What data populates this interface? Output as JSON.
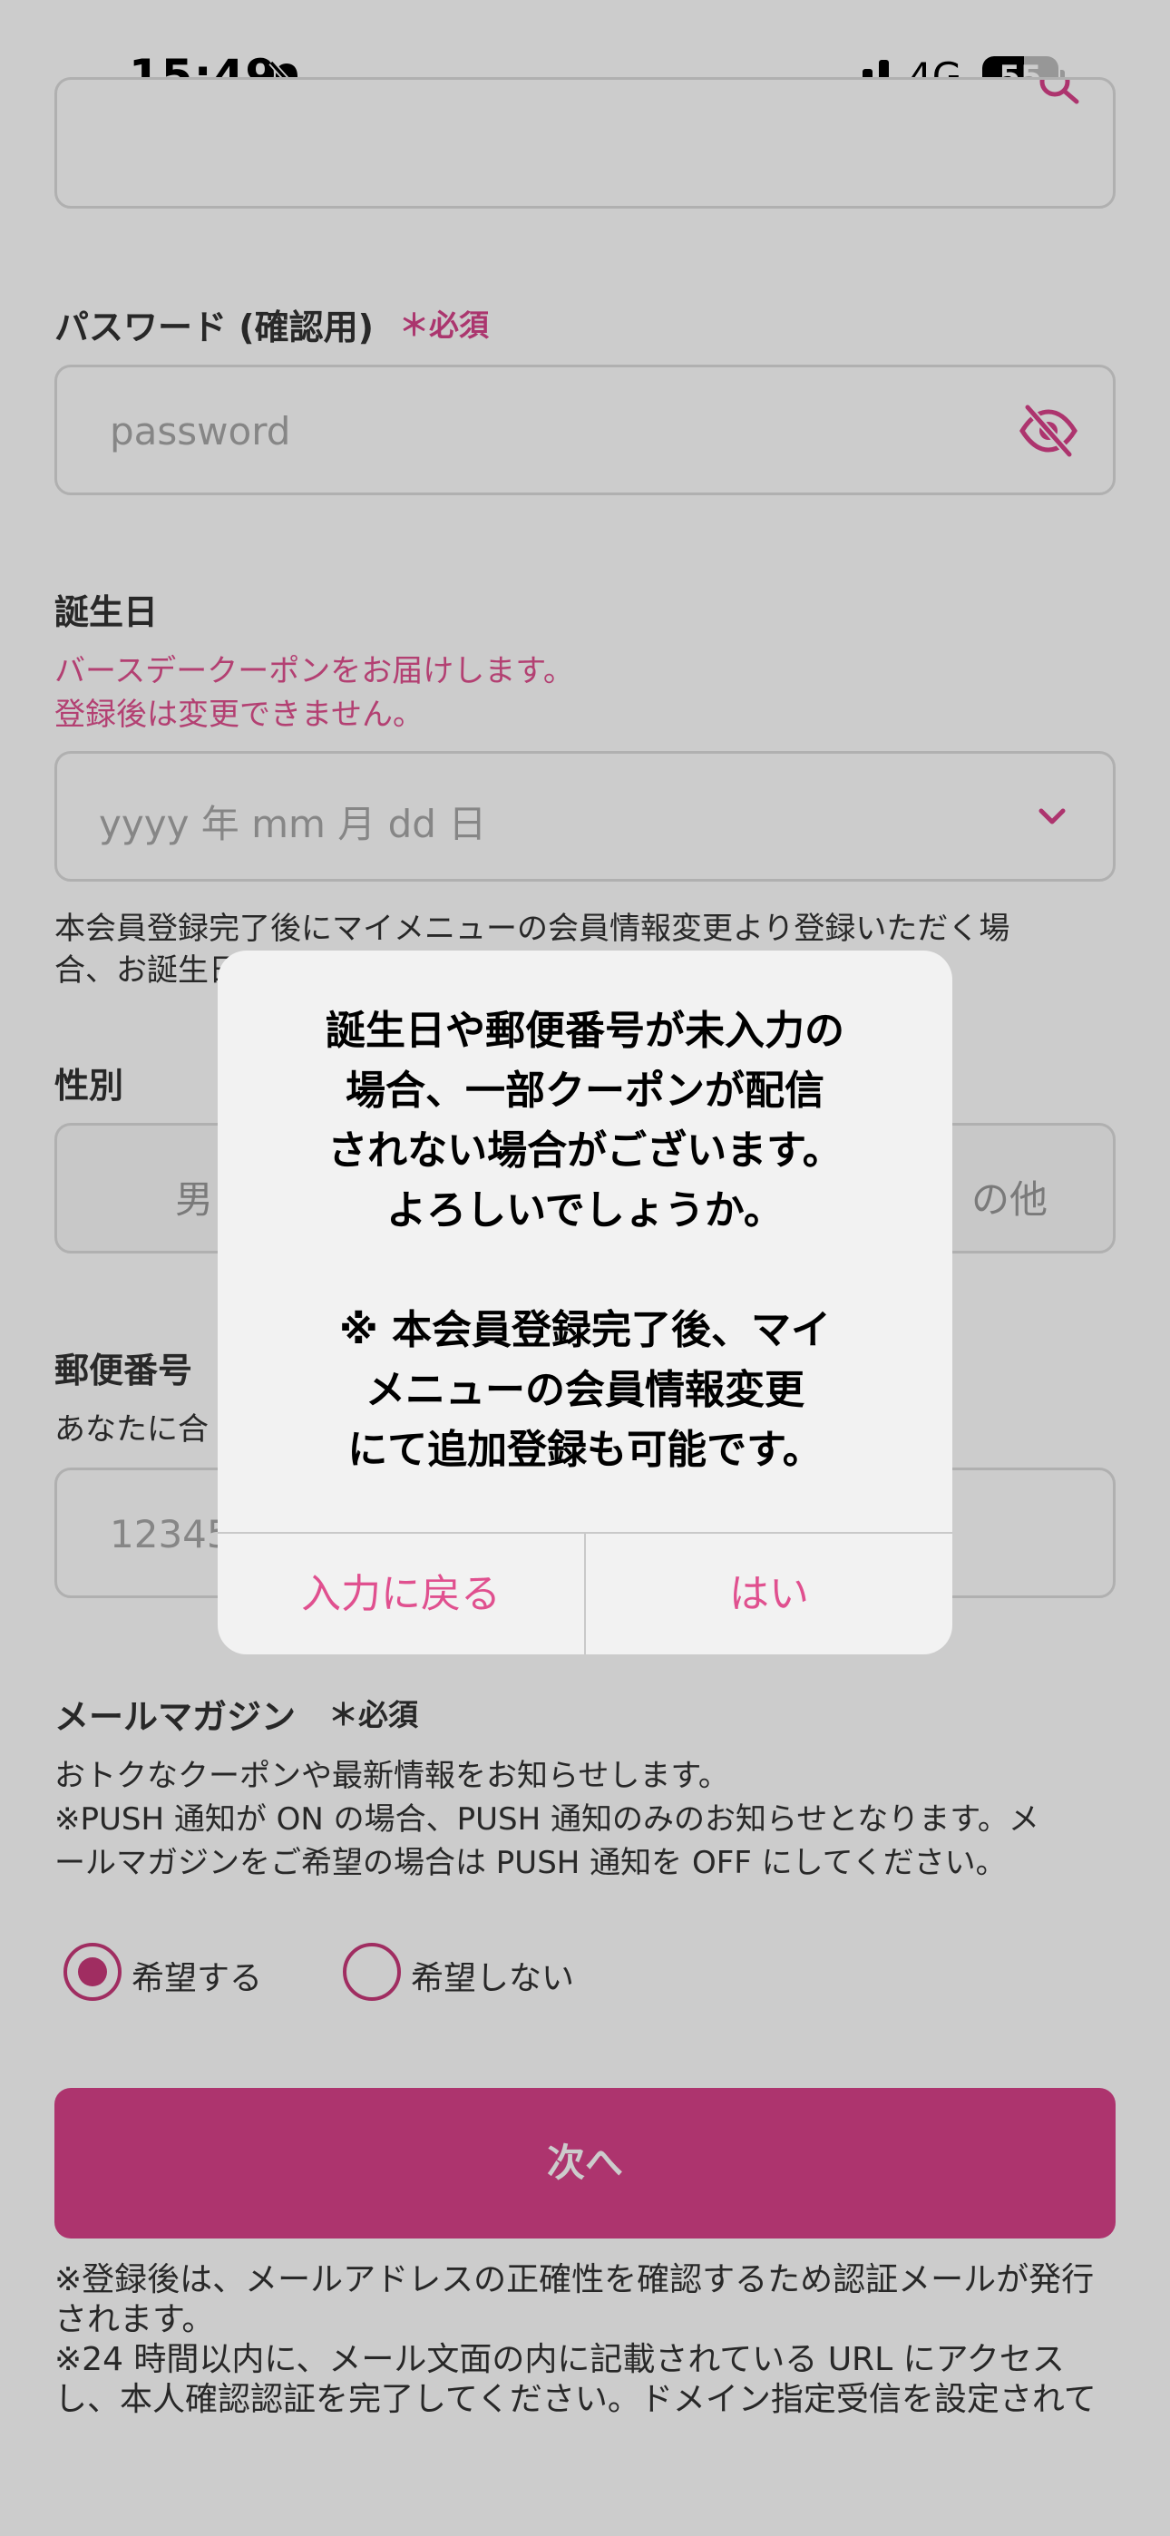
{
  "status_bar": {
    "time": "15:49",
    "network": "4G",
    "battery_level": "55",
    "battery_fraction": 0.55
  },
  "form": {
    "password_confirm": {
      "label": "パスワード (確認用)",
      "required": "＊必須",
      "placeholder": "password"
    },
    "birthday": {
      "label": "誕生日",
      "note_line1": "バースデークーポンをお届けします。",
      "note_line2": "登録後は変更できません。",
      "placeholder": "yyyy 年 mm 月 dd 日",
      "after_note_line1": "本会員登録完了後にマイメニューの会員情報変更より登録いただく場",
      "after_note_line2": "合、お誕生日"
    },
    "gender": {
      "label": "性別",
      "option_left": "男",
      "option_right": "の他"
    },
    "postal": {
      "label": "郵便番号",
      "note": "あなたに合",
      "placeholder": "12345"
    },
    "mail_magazine": {
      "label": "メールマガジン",
      "required": "＊必須",
      "desc_line1": "おトクなクーポンや最新情報をお知らせします。",
      "desc_line2": "※PUSH 通知が ON の場合、PUSH 通知のみのお知らせとなります。メ",
      "desc_line3": "ールマガジンをご希望の場合は PUSH 通知を OFF にしてください。",
      "option_yes": "希望する",
      "option_no": "希望しない"
    },
    "next_button": "次へ",
    "footer_line1": "※登録後は、メールアドレスの正確性を確認するため認証メールが発行",
    "footer_line2": "されます。",
    "footer_line3": "※24 時間以内に、メール文面の内に記載されている URL にアクセス",
    "footer_line4": "し、本人確認認証を完了してください。ドメイン指定受信を設定されて"
  },
  "dialog": {
    "line1": "誕生日や郵便番号が未入力の",
    "line2": "場合、一部クーポンが配信",
    "line3": "されない場合がございます。",
    "line4": "よろしいでしょうか。",
    "line5": "※ 本会員登録完了後、マイ",
    "line6": "メニューの会員情報変更",
    "line7": "にて追加登録も可能です。",
    "back_button": "入力に戻る",
    "yes_button": "はい"
  },
  "colors": {
    "accent": "#d9428a",
    "required": "#d6448a"
  }
}
